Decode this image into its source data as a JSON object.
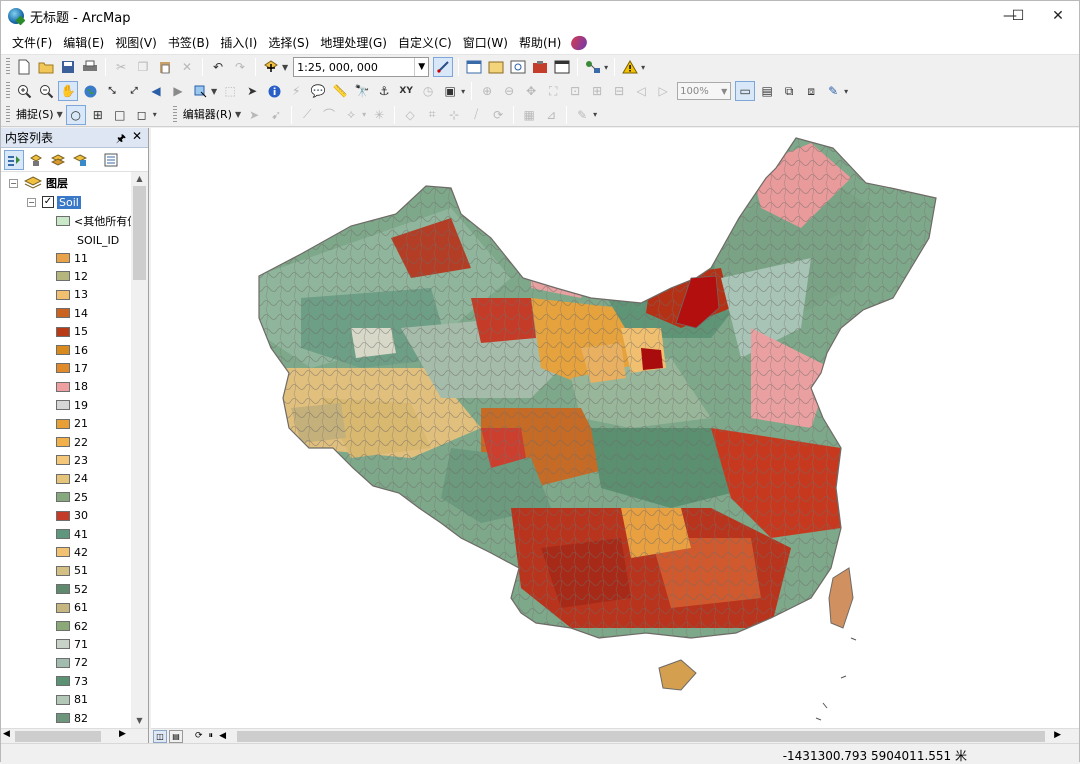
{
  "window": {
    "title": "无标题 - ArcMap",
    "minimize": "—",
    "maximize": "☐",
    "close": "✕"
  },
  "menus": [
    "文件(F)",
    "编辑(E)",
    "视图(V)",
    "书签(B)",
    "插入(I)",
    "选择(S)",
    "地理处理(G)",
    "自定义(C)",
    "窗口(W)",
    "帮助(H)"
  ],
  "toolbar": {
    "scale": "1:25, 000, 000",
    "zoom_percent": "100%",
    "snapping_label": "捕捉(S)",
    "editor_label": "编辑器(R)"
  },
  "toc": {
    "title": "内容列表",
    "root": "图层",
    "layer": "Soil",
    "other_values": "<其他所有值>",
    "field": "SOIL_ID",
    "classes": [
      {
        "label": "11",
        "color": "#e8a34a"
      },
      {
        "label": "12",
        "color": "#b5b57e"
      },
      {
        "label": "13",
        "color": "#f0c070"
      },
      {
        "label": "14",
        "color": "#c9631f"
      },
      {
        "label": "15",
        "color": "#b83a16"
      },
      {
        "label": "16",
        "color": "#d98a1c"
      },
      {
        "label": "17",
        "color": "#e08a2a"
      },
      {
        "label": "18",
        "color": "#eea0a0"
      },
      {
        "label": "19",
        "color": "#d6d6d6"
      },
      {
        "label": "21",
        "color": "#e8a036"
      },
      {
        "label": "22",
        "color": "#f2b04a"
      },
      {
        "label": "23",
        "color": "#f4c878"
      },
      {
        "label": "24",
        "color": "#e6c47a"
      },
      {
        "label": "25",
        "color": "#86a87e"
      },
      {
        "label": "30",
        "color": "#c43c28"
      },
      {
        "label": "41",
        "color": "#5f967e"
      },
      {
        "label": "42",
        "color": "#f2c272"
      },
      {
        "label": "51",
        "color": "#d4c084"
      },
      {
        "label": "52",
        "color": "#5f8a6e"
      },
      {
        "label": "61",
        "color": "#c6b680"
      },
      {
        "label": "62",
        "color": "#8aa878"
      },
      {
        "label": "71",
        "color": "#c8d2c8"
      },
      {
        "label": "72",
        "color": "#a2bcb0"
      },
      {
        "label": "73",
        "color": "#5c9274"
      },
      {
        "label": "81",
        "color": "#b4c8b8"
      },
      {
        "label": "82",
        "color": "#6e967c"
      }
    ]
  },
  "status": {
    "coordinates": "-1431300.793  5904011.551 米"
  }
}
